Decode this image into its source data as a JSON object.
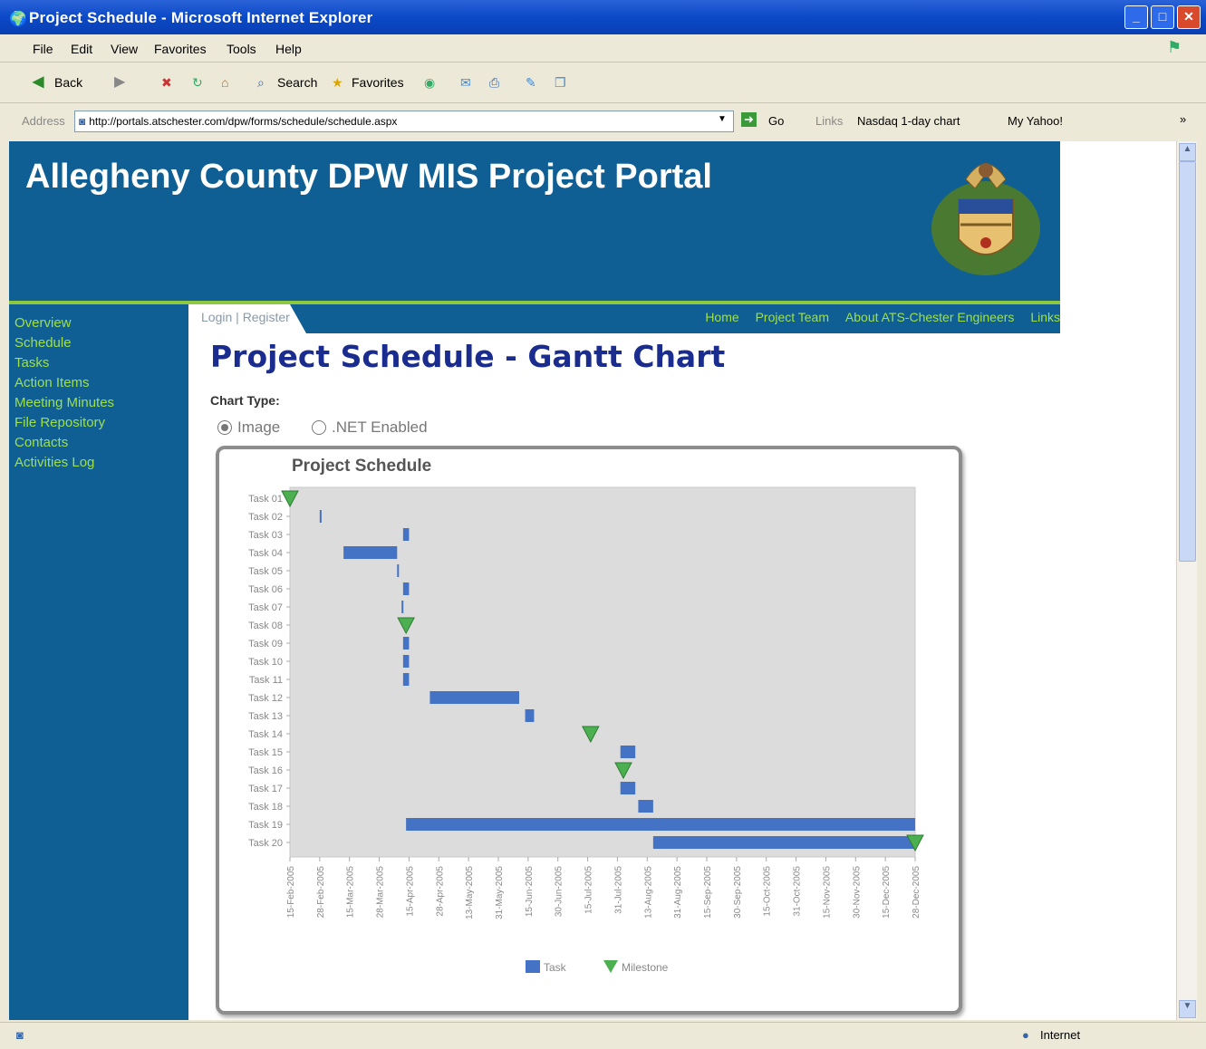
{
  "window": {
    "title": "Project Schedule - Microsoft Internet Explorer"
  },
  "menu": [
    "File",
    "Edit",
    "View",
    "Favorites",
    "Tools",
    "Help"
  ],
  "toolbar": {
    "back": "Back",
    "search": "Search",
    "favorites": "Favorites"
  },
  "address": {
    "label": "Address",
    "url": "http://portals.atschester.com/dpw/forms/schedule/schedule.aspx",
    "go": "Go",
    "links_label": "Links",
    "link1": "Nasdaq 1-day chart",
    "link2": "My Yahoo!"
  },
  "portal": {
    "title": "Allegheny County DPW MIS Project Portal"
  },
  "auth": {
    "login": "Login",
    "sep": " | ",
    "register": "Register"
  },
  "topnav": [
    "Home",
    "Project Team",
    "About ATS-Chester Engineers",
    "Links"
  ],
  "sidebar": [
    "Overview",
    "Schedule",
    "Tasks",
    "Action Items",
    "Meeting Minutes",
    "File Repository",
    "Contacts",
    "Activities Log"
  ],
  "page": {
    "heading": "Project Schedule - Gantt Chart",
    "chart_type_label": "Chart Type:",
    "option_image": "Image",
    "option_net": ".NET Enabled",
    "selected": "Image"
  },
  "status": {
    "zone": "Internet"
  },
  "colors": {
    "task": "#4472c4",
    "milestone": "#4caf50",
    "portal_blue": "#0f5f94",
    "accent_green": "#9fe04a"
  },
  "chart_data": {
    "type": "gantt",
    "title": "Project Schedule",
    "legend": [
      "Task",
      "Milestone"
    ],
    "legend_position": "bottom",
    "x_ticks": [
      "15-Feb-2005",
      "28-Feb-2005",
      "15-Mar-2005",
      "28-Mar-2005",
      "15-Apr-2005",
      "28-Apr-2005",
      "13-May-2005",
      "31-May-2005",
      "15-Jun-2005",
      "30-Jun-2005",
      "15-Jul-2005",
      "31-Jul-2005",
      "13-Aug-2005",
      "31-Aug-2005",
      "15-Sep-2005",
      "30-Sep-2005",
      "15-Oct-2005",
      "31-Oct-2005",
      "15-Nov-2005",
      "30-Nov-2005",
      "15-Dec-2005",
      "28-Dec-2005"
    ],
    "tasks": [
      {
        "name": "Task 01",
        "type": "milestone",
        "start": 0.0,
        "end": 0.0
      },
      {
        "name": "Task 02",
        "type": "task",
        "start": 1.0,
        "end": 1.05
      },
      {
        "name": "Task 03",
        "type": "task",
        "start": 3.8,
        "end": 4.0
      },
      {
        "name": "Task 04",
        "type": "task",
        "start": 1.8,
        "end": 3.6
      },
      {
        "name": "Task 05",
        "type": "task",
        "start": 3.6,
        "end": 3.65
      },
      {
        "name": "Task 06",
        "type": "task",
        "start": 3.8,
        "end": 4.0
      },
      {
        "name": "Task 07",
        "type": "task",
        "start": 3.75,
        "end": 3.8
      },
      {
        "name": "Task 08",
        "type": "milestone",
        "start": 3.9,
        "end": 3.9
      },
      {
        "name": "Task 09",
        "type": "task",
        "start": 3.8,
        "end": 4.0
      },
      {
        "name": "Task 10",
        "type": "task",
        "start": 3.8,
        "end": 4.0
      },
      {
        "name": "Task 11",
        "type": "task",
        "start": 3.8,
        "end": 4.0
      },
      {
        "name": "Task 12",
        "type": "task",
        "start": 4.7,
        "end": 7.7
      },
      {
        "name": "Task 13",
        "type": "task",
        "start": 7.9,
        "end": 8.2
      },
      {
        "name": "Task 14",
        "type": "milestone",
        "start": 10.1,
        "end": 10.1
      },
      {
        "name": "Task 15",
        "type": "task",
        "start": 11.1,
        "end": 11.6
      },
      {
        "name": "Task 16",
        "type": "milestone",
        "start": 11.2,
        "end": 11.2
      },
      {
        "name": "Task 17",
        "type": "task",
        "start": 11.1,
        "end": 11.6
      },
      {
        "name": "Task 18",
        "type": "task",
        "start": 11.7,
        "end": 12.2
      },
      {
        "name": "Task 19",
        "type": "task",
        "start": 3.9,
        "end": 21.0
      },
      {
        "name": "Task 20",
        "type": "task",
        "start": 12.2,
        "end": 21.0
      }
    ],
    "end_milestone": {
      "row": "Task 20",
      "at": 21.0
    }
  }
}
